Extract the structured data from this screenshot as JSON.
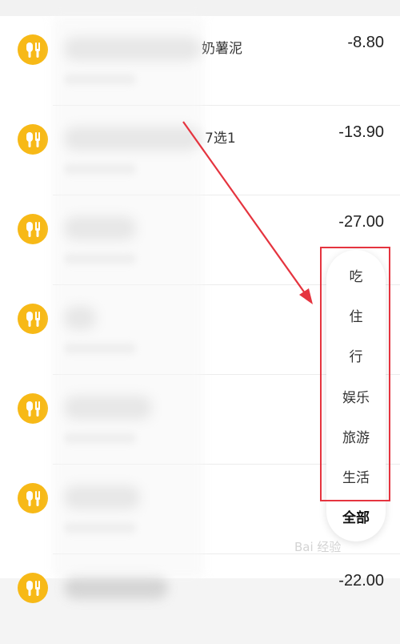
{
  "transactions": [
    {
      "title_suffix": "奶薯泥",
      "amount": "-8.80",
      "icon": "food-utensils-icon"
    },
    {
      "title_suffix": "7选1",
      "amount": "-13.90",
      "icon": "food-utensils-icon"
    },
    {
      "title_suffix": "",
      "amount": "-27.00",
      "icon": "food-utensils-icon"
    },
    {
      "title_suffix": "",
      "amount": "",
      "icon": "food-utensils-icon"
    },
    {
      "title_suffix": "",
      "amount": "",
      "icon": "food-utensils-icon"
    },
    {
      "title_suffix": "",
      "amount": "",
      "icon": "food-utensils-icon"
    },
    {
      "title_suffix": "",
      "amount": "-22.00",
      "icon": "food-utensils-icon"
    }
  ],
  "filter_menu": {
    "items": [
      "吃",
      "住",
      "行",
      "娱乐",
      "旅游",
      "生活"
    ],
    "all_label": "全部"
  },
  "watermark": "Bai 经验",
  "colors": {
    "icon_bg": "#f7b917",
    "highlight_box": "#e5343f",
    "arrow": "#e5343f"
  }
}
